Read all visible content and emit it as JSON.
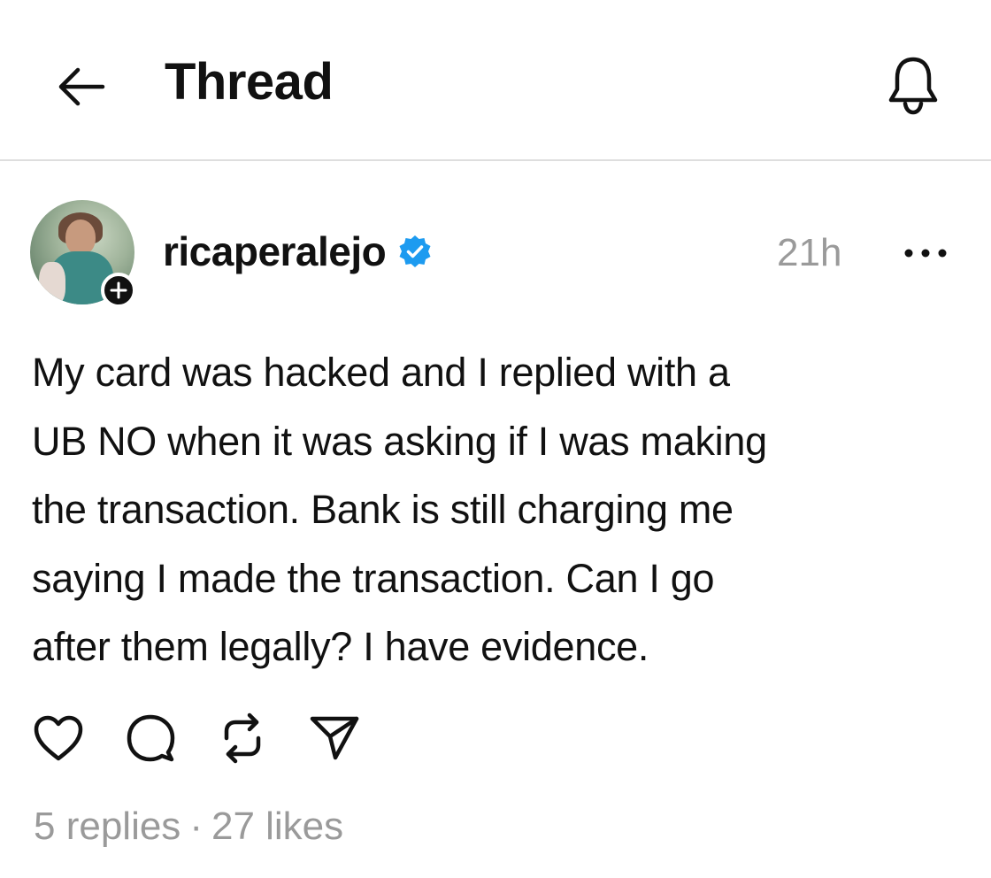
{
  "header": {
    "title": "Thread",
    "back_icon": "arrow-left-icon",
    "notification_icon": "bell-icon"
  },
  "post": {
    "username": "ricaperalejo",
    "verified_icon": "verified-badge-icon",
    "timestamp": "21h",
    "more_icon": "ellipsis-icon",
    "follow_icon": "plus-icon",
    "body_lines": [
      "My card was hacked and I replied with a",
      "UB NO when it was asking if I was making",
      "the transaction. Bank is still charging me",
      "saying I made the transaction. Can I go",
      "after them legally? I have evidence."
    ],
    "actions": [
      "heart-icon",
      "comment-icon",
      "repost-icon",
      "share-icon"
    ],
    "replies": "5 replies",
    "separator": "·",
    "likes": "27 likes"
  },
  "colors": {
    "text": "#111111",
    "muted": "#9a9a9a",
    "verified": "#1d9bf0",
    "divider": "#dedede"
  }
}
